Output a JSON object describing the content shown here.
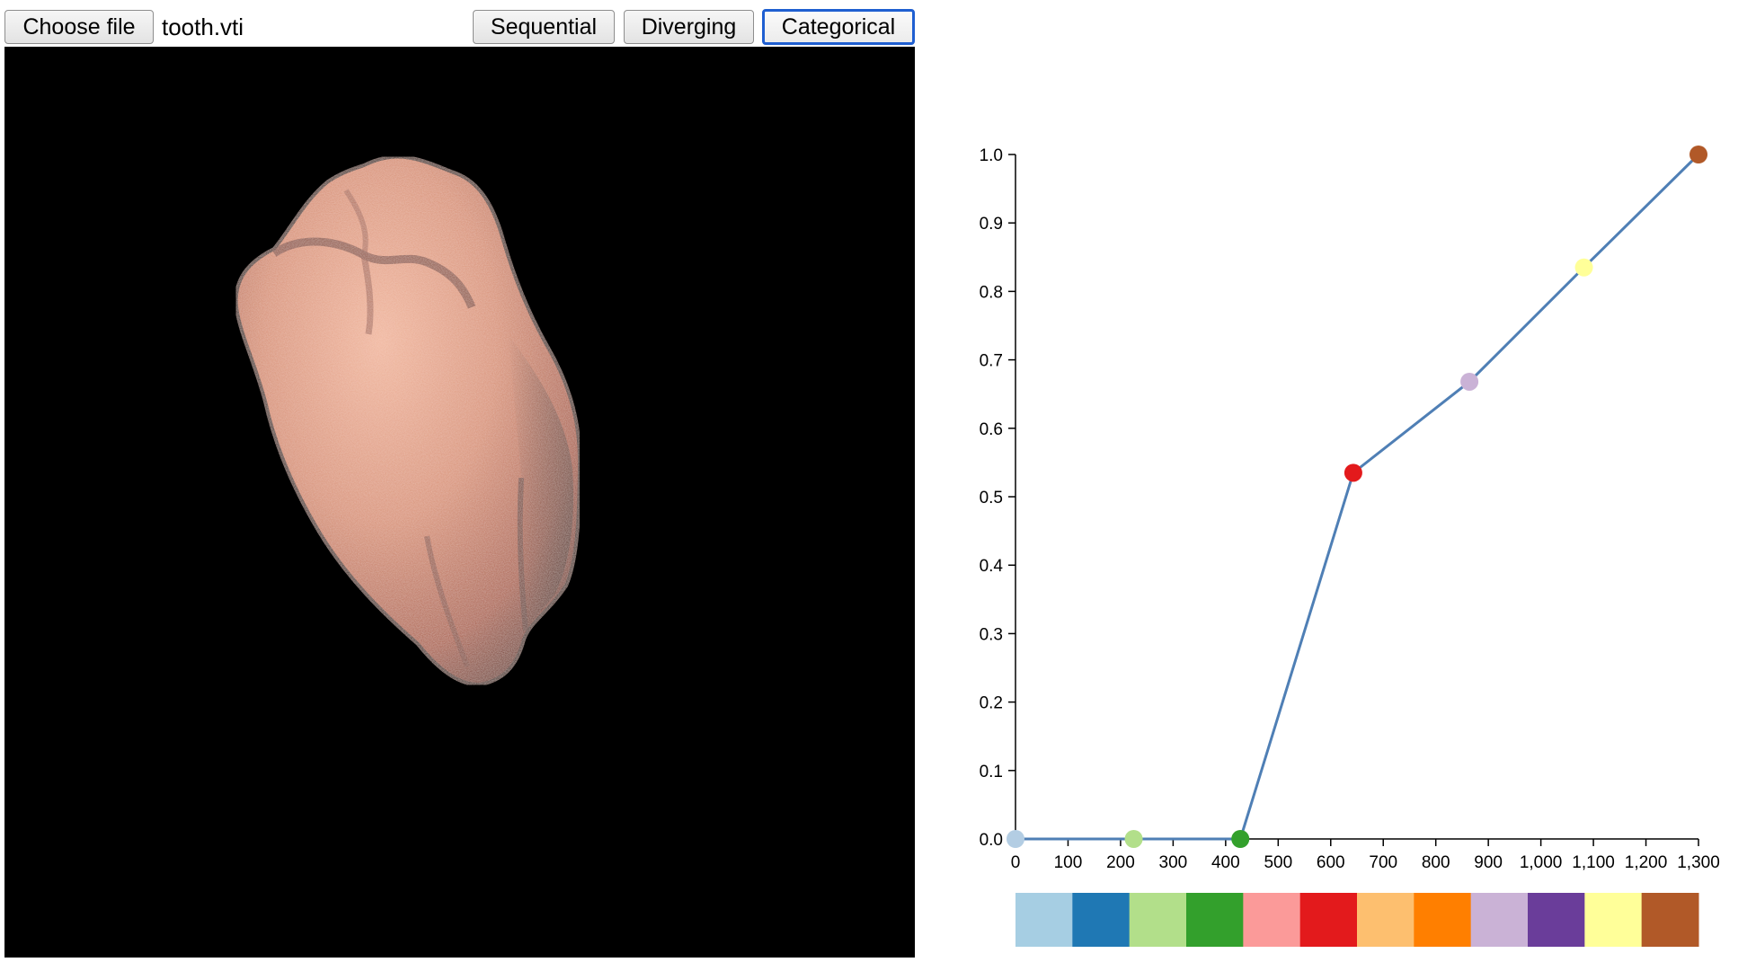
{
  "toolbar": {
    "choose_file_label": "Choose file",
    "file_name": "tooth.vti",
    "buttons": [
      {
        "label": "Sequential",
        "active": false
      },
      {
        "label": "Diverging",
        "active": false
      },
      {
        "label": "Categorical",
        "active": true
      }
    ]
  },
  "colors": {
    "line": "#4f7fb5",
    "viewport_background": "#000000",
    "active_button_border": "#1f5fd1"
  },
  "chart_data": {
    "type": "line",
    "title": "",
    "xlabel": "",
    "ylabel": "",
    "xlim": [
      0,
      1300
    ],
    "ylim": [
      0,
      1.0
    ],
    "x_ticks": [
      "0",
      "100",
      "200",
      "300",
      "400",
      "500",
      "600",
      "700",
      "800",
      "900",
      "1,000",
      "1,100",
      "1,200",
      "1,300"
    ],
    "x_tick_values": [
      0,
      100,
      200,
      300,
      400,
      500,
      600,
      700,
      800,
      900,
      1000,
      1100,
      1200,
      1300
    ],
    "y_ticks": [
      "0.0",
      "0.1",
      "0.2",
      "0.3",
      "0.4",
      "0.5",
      "0.6",
      "0.7",
      "0.8",
      "0.9",
      "1.0"
    ],
    "y_tick_values": [
      0,
      0.1,
      0.2,
      0.3,
      0.4,
      0.5,
      0.6,
      0.7,
      0.8,
      0.9,
      1.0
    ],
    "grid": false,
    "points": [
      {
        "x": 0,
        "y": 0.0,
        "color": "#b3cde3"
      },
      {
        "x": 225,
        "y": 0.0,
        "color": "#b2df8a"
      },
      {
        "x": 428,
        "y": 0.0,
        "color": "#33a02c"
      },
      {
        "x": 643,
        "y": 0.535,
        "color": "#e31a1c"
      },
      {
        "x": 864,
        "y": 0.668,
        "color": "#cab2d6"
      },
      {
        "x": 1082,
        "y": 0.835,
        "color": "#ffff99"
      },
      {
        "x": 1300,
        "y": 1.0,
        "color": "#b15928"
      }
    ],
    "color_bar": [
      "#a6cee3",
      "#1f78b4",
      "#b2df8a",
      "#33a02c",
      "#fb9a99",
      "#e31a1c",
      "#fdbf6f",
      "#ff7f00",
      "#cab2d6",
      "#6a3d9a",
      "#ffff99",
      "#b15928"
    ]
  }
}
